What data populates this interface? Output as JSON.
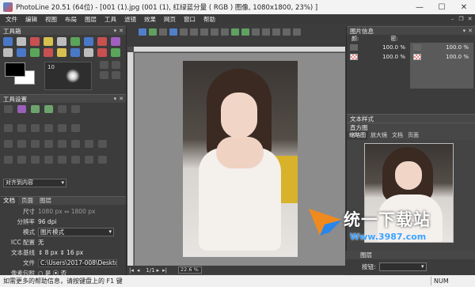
{
  "titlebar": {
    "title": "PhotoLine 20.51 (64位) - [001 (1).jpg (001 (1), 红绿蓝分量 ( RGB ) 图像, 1080x1800, 23%) ]"
  },
  "menubar": [
    "文件",
    "编辑",
    "视图",
    "布局",
    "图层",
    "工具",
    "滤镜",
    "效果",
    "网页",
    "窗口",
    "帮助"
  ],
  "left": {
    "toolbox_title": "工具箱",
    "brush_size": "10",
    "tool_settings_title": "工具设置",
    "align_select": "对齐到内容",
    "tabs": [
      "文档",
      "页面",
      "图层"
    ],
    "info": [
      {
        "label": "尺寸",
        "value": "1080 px  ⇔  1800 px",
        "dim": true
      },
      {
        "label": "分辨率",
        "value": "96 dpi"
      },
      {
        "label": "模式",
        "value": "图片模式",
        "select": true
      },
      {
        "label": "ICC 配置",
        "value": "无"
      },
      {
        "label": "文本基线",
        "value": "⇕ 8 px          ⇕ 16 px"
      },
      {
        "label": "文件",
        "value": "C:\\Users\\2017-008\\Desktop\\",
        "path": true
      },
      {
        "label": "像素包附",
        "value": "○ 是      ⦿ 否"
      }
    ]
  },
  "center": {
    "doc_tab": "PhotoLine",
    "page_indicator": "1/1",
    "zoom": "22.6 %"
  },
  "right": {
    "image_info_title": "图片信息",
    "col_labels": [
      "颜:",
      "密:"
    ],
    "layers": [
      {
        "value": "100.0 %"
      },
      {
        "value": "100.0 %"
      }
    ],
    "layers_right": [
      {
        "value": "100.0 %"
      },
      {
        "value": "100.0 %"
      }
    ],
    "text_style_title": "文本样式",
    "histogram_title": "直方图",
    "thumb_tabs": [
      "缩略图",
      "放大镜",
      "文档",
      "页面"
    ],
    "layers_title": "图层",
    "mode_label": "按钮:"
  },
  "watermark": {
    "text": "统一下载站",
    "url": "Www.3987.com"
  },
  "statusbar": {
    "text": "如需更多的帮助信息，请按键盘上的 F1 键",
    "num": "NUM"
  },
  "colors": {
    "accent": "#4a78c8",
    "canvas_bg": "#8c8c8c",
    "panel_bg": "#3c3c3c"
  }
}
